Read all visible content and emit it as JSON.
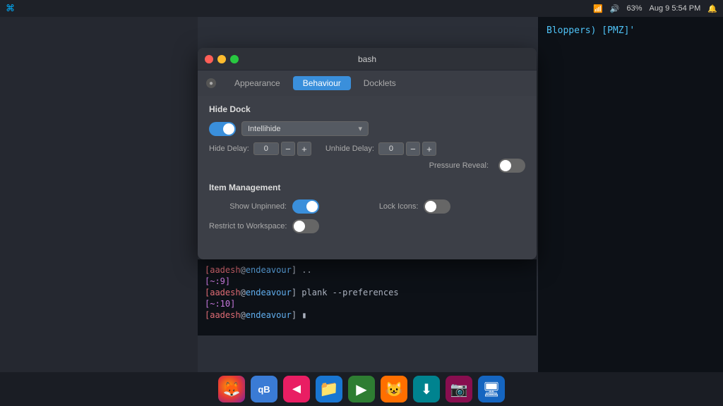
{
  "topbar": {
    "time": "Aug 9  5:54 PM",
    "battery": "63%",
    "logo": "A"
  },
  "dialog": {
    "title": "bash",
    "tabs": [
      {
        "id": "appearance",
        "label": "Appearance",
        "active": false
      },
      {
        "id": "behaviour",
        "label": "Behaviour",
        "active": true
      },
      {
        "id": "docklets",
        "label": "Docklets",
        "active": false
      }
    ],
    "sections": {
      "hide_dock": {
        "title": "Hide Dock",
        "toggle_on": true,
        "dropdown_value": "Intellihide",
        "hide_delay_label": "Hide Delay:",
        "hide_delay_value": "0",
        "unhide_delay_label": "Unhide Delay:",
        "unhide_delay_value": "0",
        "pressure_reveal_label": "Pressure Reveal:",
        "pressure_reveal_on": false
      },
      "item_management": {
        "title": "Item Management",
        "show_unpinned_label": "Show Unpinned:",
        "show_unpinned_on": true,
        "lock_icons_label": "Lock Icons:",
        "lock_icons_on": false,
        "restrict_workspace_label": "Restrict to Workspace:",
        "restrict_workspace_on": false
      }
    }
  },
  "terminal": {
    "lines": [
      {
        "user": "aadesh",
        "host": "endeavour",
        "prompt": "] ..",
        "class": "normal"
      },
      {
        "bracket": "[~:9]",
        "class": "bracket"
      },
      {
        "user": "aadesh",
        "host": "endeavour",
        "prompt": "] plank --preferences",
        "class": "normal"
      },
      {
        "bracket": "[~:10]",
        "class": "bracket"
      },
      {
        "user": "aadesh",
        "host": "endeavour",
        "prompt": "] ▮",
        "class": "normal"
      }
    ]
  },
  "right_terminal": {
    "text": "Bloppers) [PMZ]'"
  },
  "dock": {
    "icons": [
      {
        "id": "firefox",
        "symbol": "🦊",
        "class": "dock-firefox"
      },
      {
        "id": "qbittorrent",
        "symbol": "qB",
        "class": "dock-qb"
      },
      {
        "id": "send",
        "symbol": "◄",
        "class": "dock-send"
      },
      {
        "id": "files",
        "symbol": "🗀",
        "class": "dock-files"
      },
      {
        "id": "media",
        "symbol": "▶",
        "class": "dock-media"
      },
      {
        "id": "fox",
        "symbol": "😺",
        "class": "dock-fox"
      },
      {
        "id": "downloader",
        "symbol": "⬇",
        "class": "dock-dl"
      },
      {
        "id": "camera",
        "symbol": "📷",
        "class": "dock-camera"
      },
      {
        "id": "present",
        "symbol": "🖥",
        "class": "dock-present"
      }
    ]
  }
}
